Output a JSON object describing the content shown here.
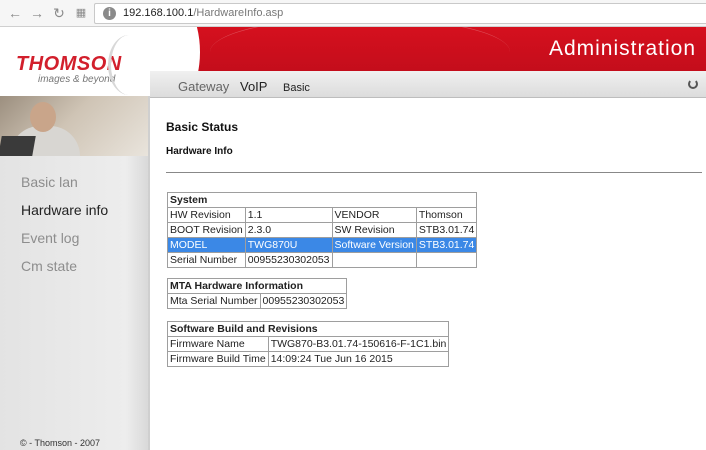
{
  "browser": {
    "url_host": "192.168.100.1",
    "url_path": "/HardwareInfo.asp"
  },
  "header": {
    "logo_main": "THOMSON",
    "logo_sub": "images & beyond",
    "title": "Administration",
    "tabs": [
      "Gateway",
      "VoIP",
      "Basic"
    ]
  },
  "sidebar": {
    "items": [
      "Basic lan",
      "Hardware info",
      "Event log",
      "Cm state"
    ],
    "footer": "© - Thomson - 2007"
  },
  "main": {
    "heading": "Basic Status",
    "subheading": "Hardware Info",
    "system": {
      "title": "System",
      "rows": [
        [
          "HW Revision",
          "1.1",
          "VENDOR",
          "Thomson"
        ],
        [
          "BOOT Revision",
          "2.3.0",
          "SW Revision",
          "STB3.01.74"
        ],
        [
          "MODEL",
          "TWG870U",
          "Software Version",
          "STB3.01.74"
        ],
        [
          "Serial Number",
          "00955230302053",
          "",
          ""
        ]
      ]
    },
    "mta": {
      "title": "MTA Hardware Information",
      "rows": [
        [
          "Mta Serial Number",
          "00955230302053"
        ]
      ]
    },
    "software": {
      "title": "Software Build and Revisions",
      "rows": [
        [
          "Firmware Name",
          "TWG870-B3.01.74-150616-F-1C1.bin"
        ],
        [
          "Firmware Build Time",
          "14:09:24 Tue Jun 16 2015"
        ]
      ]
    }
  }
}
